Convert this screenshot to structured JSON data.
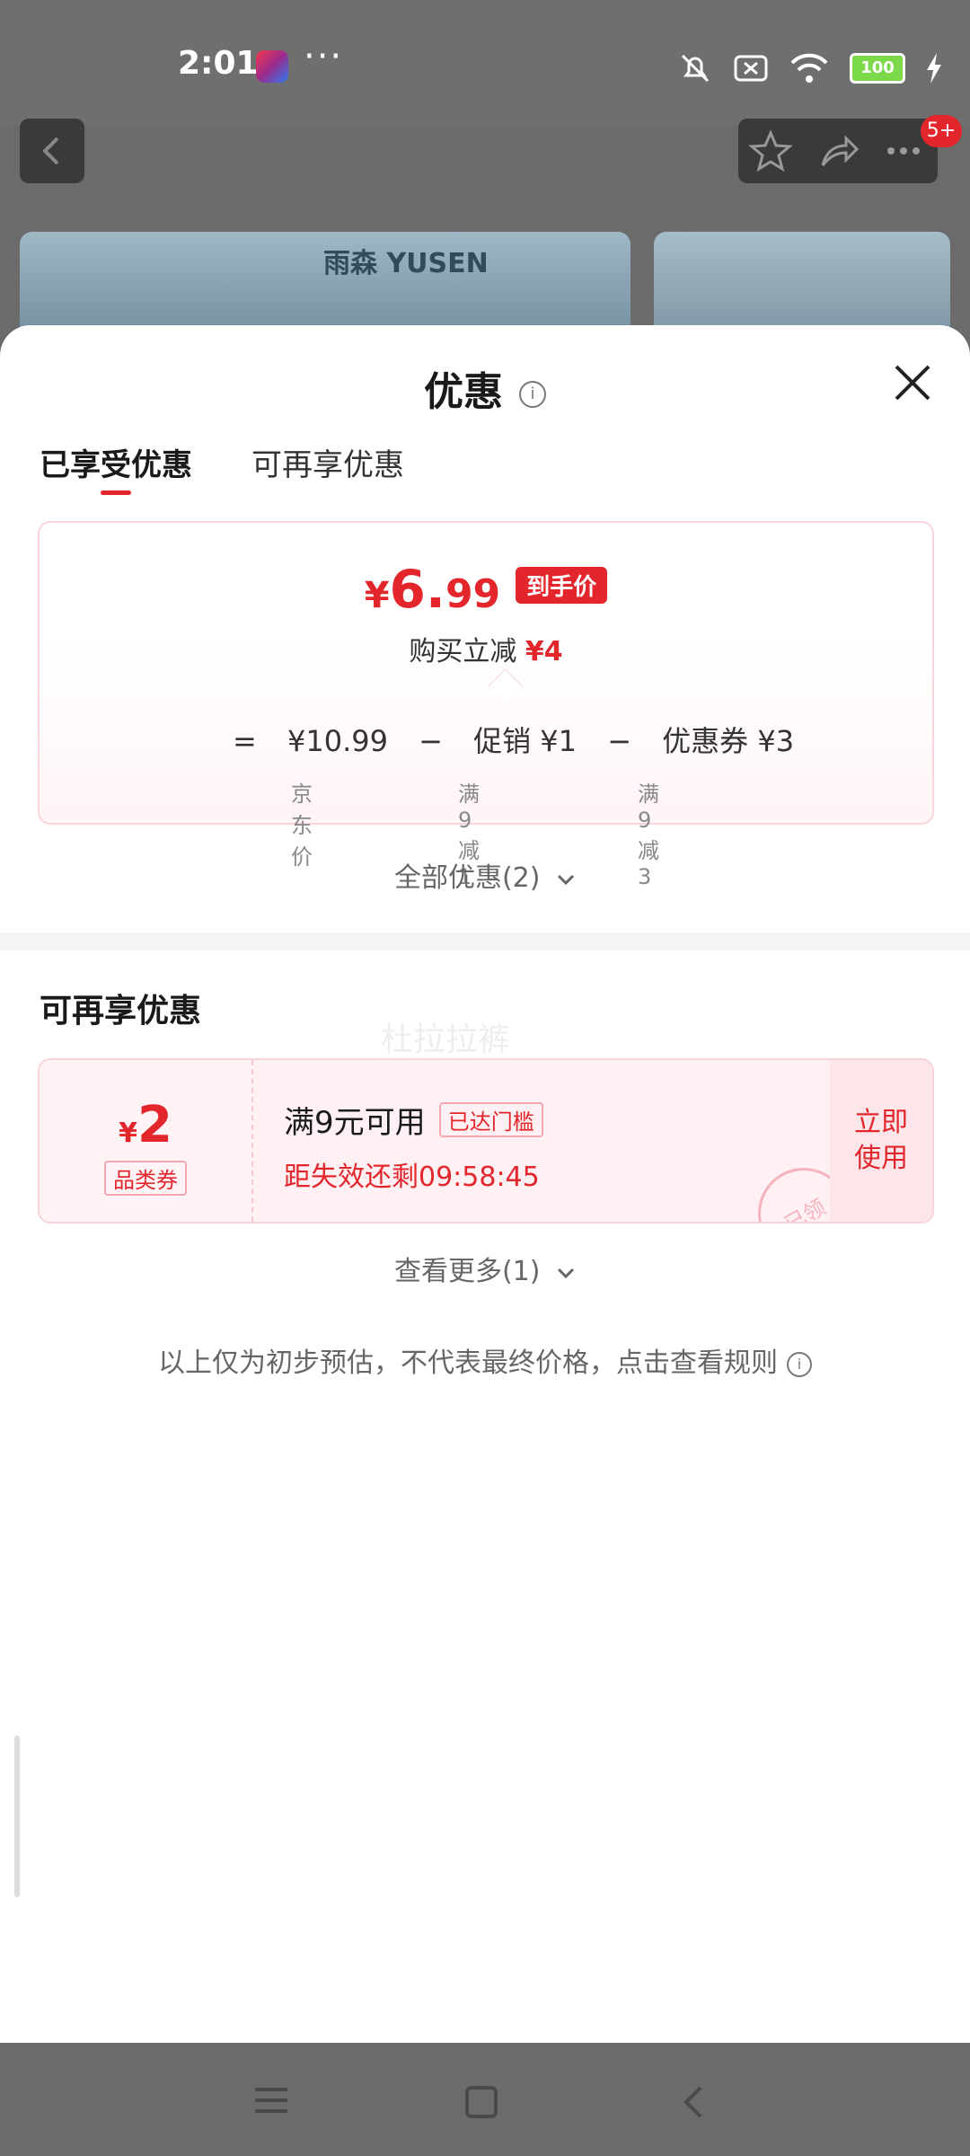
{
  "status_bar": {
    "time": "2:01",
    "dots": "···",
    "battery": "100"
  },
  "nav": {
    "badge": "5+"
  },
  "banner": {
    "brand_text": "雨森 YUSEN"
  },
  "sheet": {
    "title": "优惠",
    "tabs": [
      "已享受优惠",
      "可再享优惠"
    ],
    "price": {
      "symbol": "¥",
      "integer": "6.",
      "decimal": "99",
      "tag": "到手价"
    },
    "reduce": {
      "label": "购买立减",
      "amount": "¥4"
    },
    "formula": {
      "eq": "=",
      "base_price": "¥10.99",
      "minus1": "−",
      "promo": "促销 ¥1",
      "minus2": "−",
      "coupon": "优惠券 ¥3",
      "notes": [
        "京东价",
        "满9减1",
        "满9减3"
      ]
    },
    "all_offers": "全部优惠(2)",
    "more_section_title": "可再享优惠",
    "ghost_text": "杜拉拉裤",
    "coupon": {
      "symbol": "¥",
      "value": "2",
      "type": "品类券",
      "condition": "满9元可用",
      "reached": "已达门槛",
      "expire": "距失效还剩09:58:45",
      "action_line1": "立即",
      "action_line2": "使用",
      "stamp": "已领"
    },
    "see_more": "查看更多(1)",
    "disclaimer": "以上仅为初步预估，不代表最终价格，点击查看规则"
  },
  "colors": {
    "accent": "#e3262c",
    "overlay": "#6b6b6b"
  }
}
